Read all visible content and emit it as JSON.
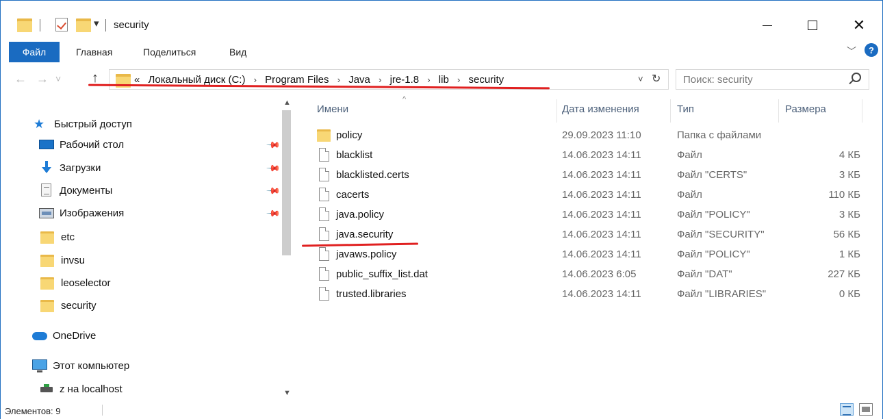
{
  "window": {
    "title": "security",
    "qa_dropdown": "▾",
    "controls": {
      "close": "✕"
    }
  },
  "ribbon": {
    "tabs": [
      "Файл",
      "Главная",
      "Поделиться",
      "Вид"
    ],
    "expand_chevron": "﹀",
    "help": "?"
  },
  "nav": {
    "back": "←",
    "forward": "→",
    "recent": "˅",
    "up": "↑"
  },
  "address": {
    "overflow": "«",
    "crumbs": [
      "Локальный диск (C:)",
      "Program Files",
      "Java",
      "jre-1.8",
      "lib",
      "security"
    ],
    "separator": "›",
    "dropdown": "˅",
    "refresh": "↻"
  },
  "search": {
    "placeholder": "Поиск: security"
  },
  "sidebar": {
    "quick_access": "Быстрый доступ",
    "items": [
      {
        "label": "Рабочий стол",
        "icon": "desktop-icon",
        "pinned": true
      },
      {
        "label": "Загрузки",
        "icon": "downloads-icon",
        "pinned": true
      },
      {
        "label": "Документы",
        "icon": "documents-icon",
        "pinned": true
      },
      {
        "label": "Изображения",
        "icon": "pictures-icon",
        "pinned": true
      },
      {
        "label": "etc",
        "icon": "folder-icon",
        "pinned": false
      },
      {
        "label": "invsu",
        "icon": "folder-icon",
        "pinned": false
      },
      {
        "label": "leoselector",
        "icon": "folder-icon",
        "pinned": false
      },
      {
        "label": "security",
        "icon": "folder-icon",
        "pinned": false
      }
    ],
    "onedrive": "OneDrive",
    "this_pc": "Этот компьютер",
    "network_drive": "z на localhost"
  },
  "files": {
    "columns": {
      "name": "Имени",
      "date": "Дата изменения",
      "type": "Тип",
      "size": "Размера"
    },
    "sort_indicator": "^",
    "rows": [
      {
        "name": "policy",
        "date": "29.09.2023 11:10",
        "type": "Папка с файлами",
        "size": "",
        "icon": "folder-icon"
      },
      {
        "name": "blacklist",
        "date": "14.06.2023 14:11",
        "type": "Файл",
        "size": "4 КБ",
        "icon": "file-icon"
      },
      {
        "name": "blacklisted.certs",
        "date": "14.06.2023 14:11",
        "type": "Файл \"CERTS\"",
        "size": "3 КБ",
        "icon": "file-icon"
      },
      {
        "name": "cacerts",
        "date": "14.06.2023 14:11",
        "type": "Файл",
        "size": "110 КБ",
        "icon": "file-icon"
      },
      {
        "name": "java.policy",
        "date": "14.06.2023 14:11",
        "type": "Файл \"POLICY\"",
        "size": "3 КБ",
        "icon": "file-icon"
      },
      {
        "name": "java.security",
        "date": "14.06.2023 14:11",
        "type": "Файл \"SECURITY\"",
        "size": "56 КБ",
        "icon": "file-icon"
      },
      {
        "name": "javaws.policy",
        "date": "14.06.2023 14:11",
        "type": "Файл \"POLICY\"",
        "size": "1 КБ",
        "icon": "file-icon"
      },
      {
        "name": "public_suffix_list.dat",
        "date": "14.06.2023 6:05",
        "type": "Файл \"DAT\"",
        "size": "227 КБ",
        "icon": "file-icon"
      },
      {
        "name": "trusted.libraries",
        "date": "14.06.2023 14:11",
        "type": "Файл \"LIBRARIES\"",
        "size": "0 КБ",
        "icon": "file-icon"
      }
    ]
  },
  "status": {
    "count": "Элементов: 9"
  },
  "colors": {
    "accent": "#1a6bc1",
    "annotation_underline": "#e02020",
    "folder": "#f8d775"
  }
}
